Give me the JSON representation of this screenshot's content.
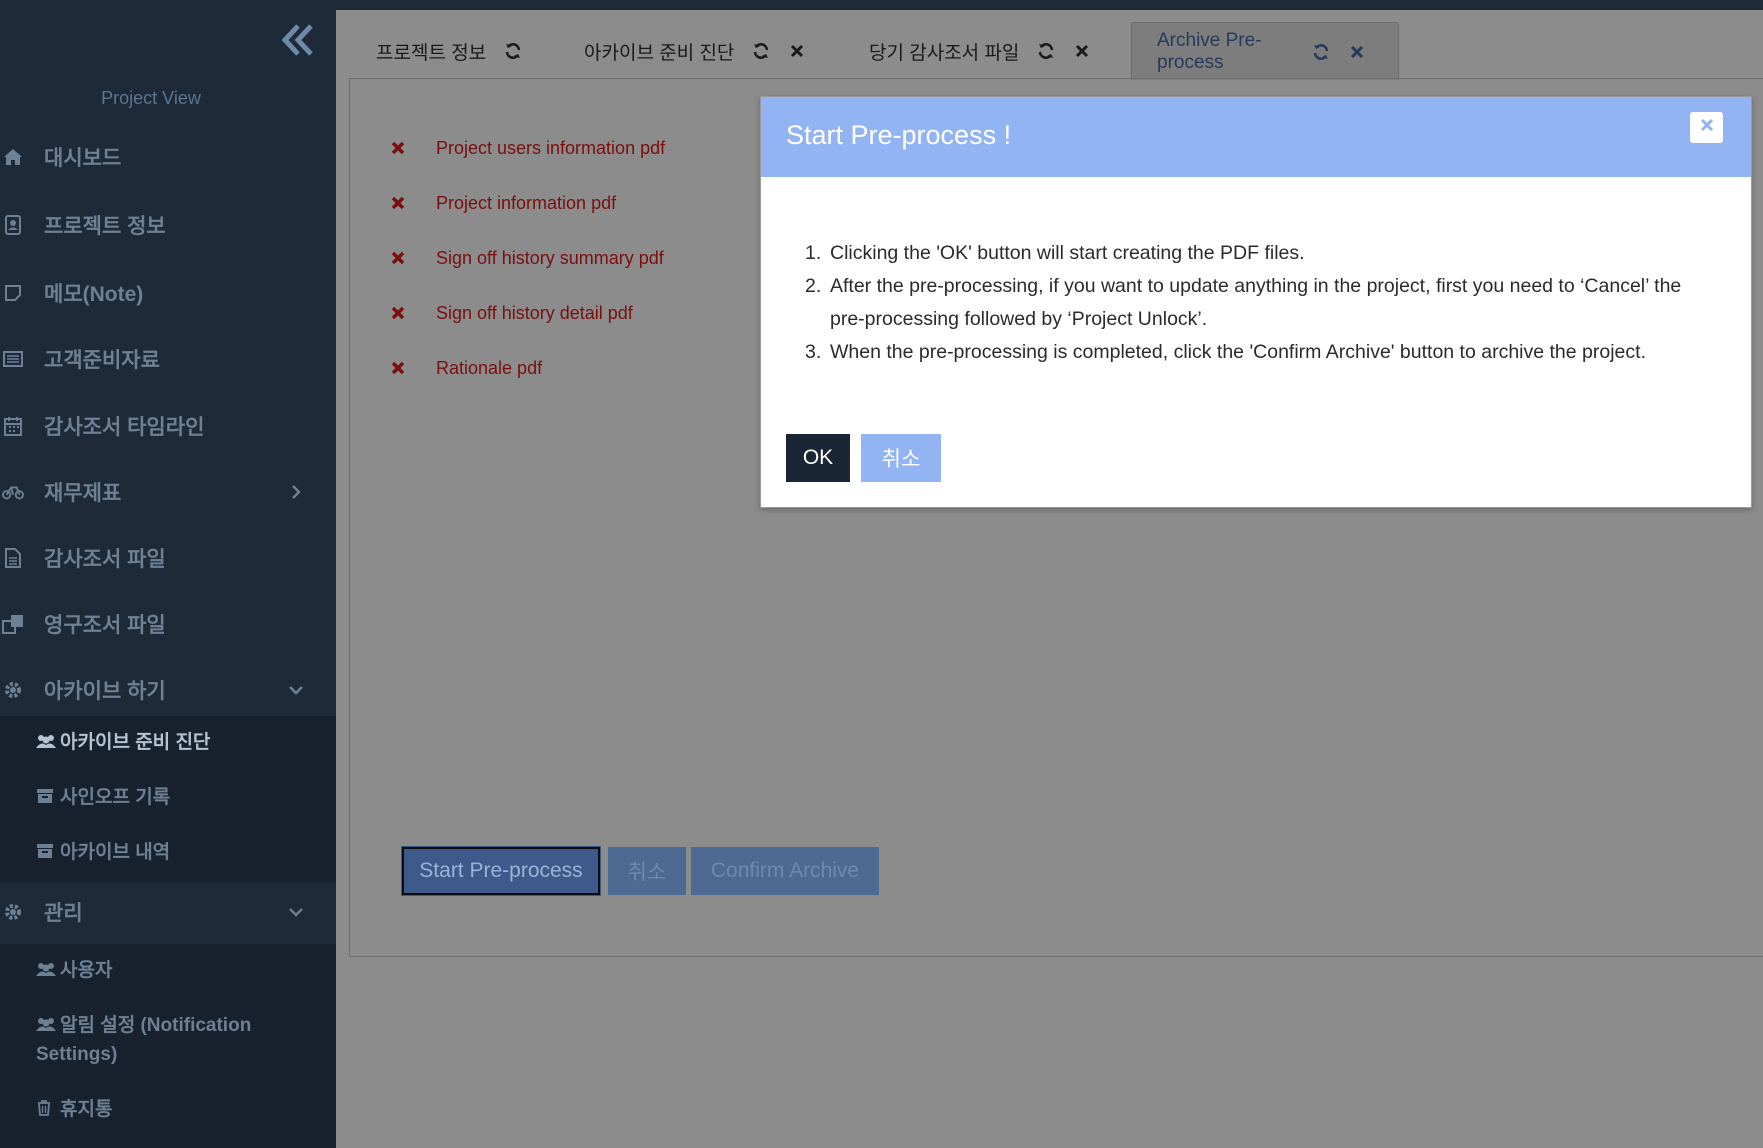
{
  "sidebar": {
    "title": "Project View",
    "items": [
      {
        "label": "대시보드",
        "icon": "home-icon"
      },
      {
        "label": "프로젝트 정보",
        "icon": "contact-card-icon"
      },
      {
        "label": "메모(Note)",
        "icon": "sticky-note-icon"
      },
      {
        "label": "고객준비자료",
        "icon": "list-box-icon"
      },
      {
        "label": "감사조서 타임라인",
        "icon": "calendar-icon"
      },
      {
        "label": "재무제표",
        "icon": "bicycle-icon"
      },
      {
        "label": "감사조서 파일",
        "icon": "document-icon"
      },
      {
        "label": "영구조서 파일",
        "icon": "clone-icon"
      },
      {
        "label": "아카이브 하기",
        "icon": "gear-icon"
      },
      {
        "label": "관리",
        "icon": "gear-icon"
      }
    ],
    "archive_sub": [
      {
        "label": "아카이브 준비 진단",
        "icon": "users-icon"
      },
      {
        "label": "사인오프 기록",
        "icon": "archive-box-icon"
      },
      {
        "label": "아카이브 내역",
        "icon": "archive-box-icon"
      }
    ],
    "admin_sub": [
      {
        "label": "사용자",
        "icon": "users-icon"
      },
      {
        "label": "알림 설정 (Notification",
        "label2": "Settings)",
        "icon": "users-icon"
      },
      {
        "label": "휴지통",
        "icon": "trash-icon"
      }
    ]
  },
  "tabs": [
    {
      "label": "프로젝트 정보"
    },
    {
      "label": "아카이브 준비 진단"
    },
    {
      "label": "당기 감사조서 파일"
    },
    {
      "label": "Archive Pre-process"
    }
  ],
  "files": [
    "Project users information pdf",
    "Project information pdf",
    "Sign off history summary pdf",
    "Sign off history detail pdf",
    "Rationale pdf"
  ],
  "buttons": {
    "start": "Start Pre-process",
    "cancel": "취소",
    "confirm": "Confirm Archive"
  },
  "modal": {
    "title": "Start Pre-process !",
    "steps": [
      "Clicking the 'OK' button will start creating the PDF files.",
      "After the pre-processing, if you want to update anything in the project, first you need to ‘Cancel’ the pre-processing followed by ‘Project Unlock’.",
      "When the pre-processing is completed, click the 'Confirm Archive' button to archive the project."
    ],
    "ok_label": "OK",
    "cancel_label": "취소"
  },
  "colors": {
    "sidebar_bg": "#1e2a38",
    "modal_header": "#93b4f2",
    "file_error": "#7a0f0f",
    "ok_button": "#1a2535"
  }
}
